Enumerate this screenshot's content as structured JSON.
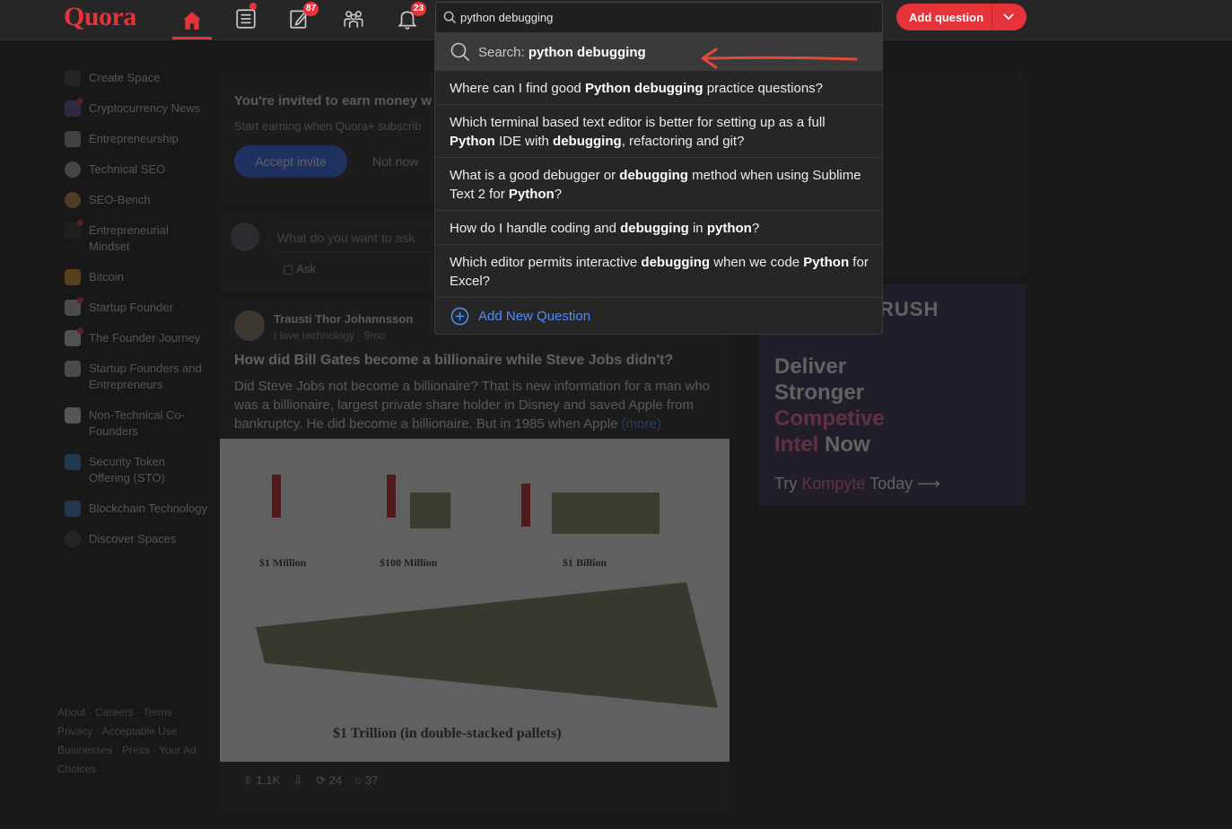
{
  "brand": "Quora",
  "colors": {
    "accent": "#e5333a",
    "link": "#4b8dff"
  },
  "nav": {
    "home_icon": "home-icon",
    "following_icon": "following-icon",
    "answer_icon": "answer-pen-icon",
    "answer_badge": "87",
    "spaces_icon": "spaces-icon",
    "notifications_icon": "bell-icon",
    "notifications_badge": "23"
  },
  "search": {
    "value": "python debugging"
  },
  "add_question": {
    "label": "Add question"
  },
  "dropdown": {
    "search_prefix": "Search: ",
    "search_term": "python debugging",
    "suggestions": [
      {
        "parts": [
          "Where can I find good ",
          "Python debugging",
          " practice questions?"
        ]
      },
      {
        "parts": [
          "Which terminal based text editor is better for setting up as a full ",
          "Python",
          " IDE with ",
          "debugging",
          ", refactoring and git?"
        ]
      },
      {
        "parts": [
          "What is a good debugger or ",
          "debugging",
          " method when using Sublime Text 2 for ",
          "Python",
          "?"
        ]
      },
      {
        "parts": [
          "How do I handle coding and ",
          "debugging",
          " in ",
          "python",
          "?"
        ]
      },
      {
        "parts": [
          "Which editor permits interactive ",
          "debugging",
          " when we code ",
          "Python",
          " for Excel?"
        ]
      }
    ],
    "add_new": "Add New Question"
  },
  "sidebar": {
    "items": [
      {
        "label": "Create Space"
      },
      {
        "label": "Cryptocurrency News"
      },
      {
        "label": "Entrepreneurship"
      },
      {
        "label": "Technical SEO"
      },
      {
        "label": "SEO-Bench"
      },
      {
        "label": "Entrepreneurial Mindset"
      },
      {
        "label": "Bitcoin"
      },
      {
        "label": "Startup Founder"
      },
      {
        "label": "The Founder Journey"
      },
      {
        "label": "Startup Founders and Entrepreneurs"
      },
      {
        "label": "Non-Technical Co-Founders"
      },
      {
        "label": "Security Token Offering (STO)"
      },
      {
        "label": "Blockchain Technology"
      },
      {
        "label": "Discover Spaces"
      }
    ],
    "footer": "About · Careers · Terms · Privacy · Acceptable Use · Businesses · Press · Your Ad Choices"
  },
  "invite": {
    "title": "You're invited to earn money w",
    "subtitle": "Start earning when Quora+ subscrib",
    "accept": "Accept invite",
    "not_now": "Not now"
  },
  "ask": {
    "placeholder": "What do you want to ask",
    "ask_label": "Ask"
  },
  "post": {
    "author": "Trausti Thor Johannsson",
    "credential": "I love technology · 9mo",
    "question": "How did Bill Gates become a billionaire while Steve Jobs didn't?",
    "body": "Did Steve Jobs not become a billionaire? That is new information for a man who was a billionaire, largest private share holder in Disney and saved Apple from bankruptcy. He did become a billionaire. But in 1985 when Apple",
    "more": "(more)",
    "image_labels": [
      "$1 Million",
      "$100 Million",
      "$1 Billion",
      "$1 Trillion (in double-stacked pallets)"
    ],
    "upvotes": "1.1K",
    "shares": "24",
    "comments": "37"
  },
  "ad": {
    "brand": "RUSH",
    "headline_1": "Deliver",
    "headline_2": "Stronger",
    "headline_3": "Competive",
    "headline_4": "Intel",
    "headline_5": "Now",
    "cta_1": "Try",
    "cta_2": "Kompyte",
    "cta_3": "Today"
  }
}
